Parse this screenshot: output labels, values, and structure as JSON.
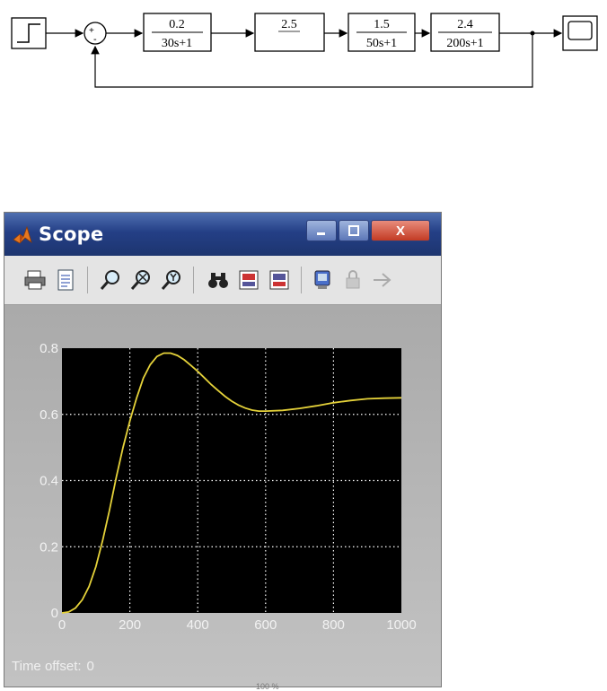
{
  "diagram": {
    "gain1": {
      "num": "0.2",
      "den": "30s+1"
    },
    "gain2": {
      "label": "2.5"
    },
    "tf3": {
      "num": "1.5",
      "den": "50s+1"
    },
    "tf4": {
      "num": "2.4",
      "den": "200s+1"
    },
    "sum": {
      "plus": "+",
      "minus": "-"
    },
    "icons": [
      "step-source-icon",
      "sum-junction-icon",
      "scope-sink-icon"
    ]
  },
  "window": {
    "title": "Scope",
    "close_label": "X",
    "icons": [
      "print-icon",
      "parameters-icon",
      "zoom-icon",
      "zoom-x-icon",
      "zoom-y-icon",
      "autoscale-icon",
      "save-axes-icon",
      "restore-axes-icon",
      "floating-scope-icon",
      "lock-axes-icon",
      "signal-selection-icon"
    ]
  },
  "chart_data": {
    "type": "line",
    "title": "",
    "xlabel": "",
    "ylabel": "",
    "xlim": [
      0,
      1000
    ],
    "ylim": [
      0,
      0.8
    ],
    "xticks": [
      "0",
      "200",
      "400",
      "600",
      "800",
      "1000"
    ],
    "yticks": [
      "0",
      "0.2",
      "0.4",
      "0.6",
      "0.8"
    ],
    "grid": true,
    "series": [
      {
        "x": [
          0,
          20,
          40,
          60,
          80,
          100,
          120,
          140,
          160,
          180,
          200,
          220,
          240,
          260,
          280,
          300,
          320,
          340,
          360,
          380,
          400,
          420,
          440,
          460,
          480,
          500,
          520,
          540,
          560,
          580,
          600,
          650,
          700,
          750,
          800,
          850,
          900,
          950,
          1000
        ],
        "y": [
          0,
          0.003,
          0.015,
          0.04,
          0.08,
          0.14,
          0.22,
          0.31,
          0.41,
          0.5,
          0.58,
          0.65,
          0.71,
          0.75,
          0.775,
          0.785,
          0.785,
          0.778,
          0.765,
          0.748,
          0.73,
          0.71,
          0.69,
          0.672,
          0.655,
          0.64,
          0.628,
          0.619,
          0.613,
          0.61,
          0.61,
          0.612,
          0.618,
          0.626,
          0.635,
          0.642,
          0.647,
          0.649,
          0.65
        ],
        "color": "#e5d23a"
      }
    ]
  },
  "status": {
    "time_offset_label": "Time offset:",
    "time_offset_value": "0",
    "zoom_text": "100 %"
  },
  "colors": {
    "plot_bg": "#000000",
    "grid": "#ffffff",
    "trace": "#e5d23a",
    "title_bar": "#243f86"
  }
}
